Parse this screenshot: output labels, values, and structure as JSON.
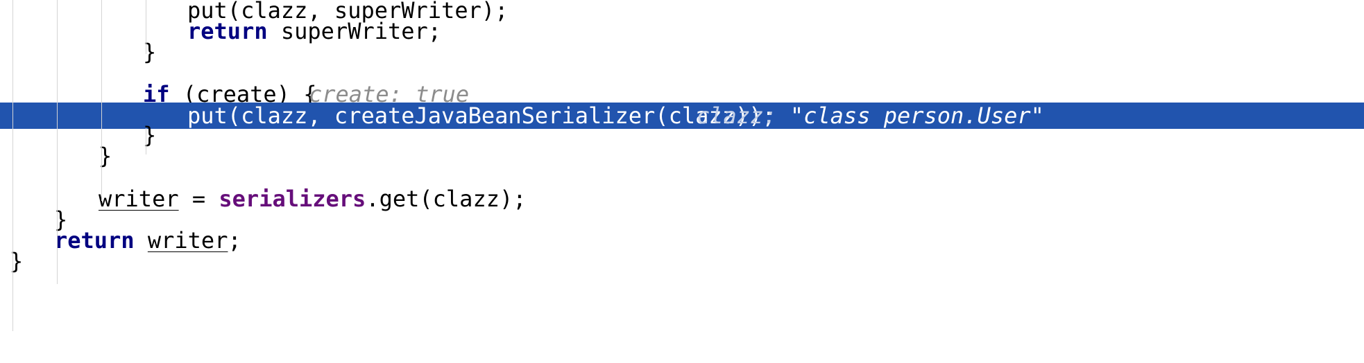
{
  "editor": {
    "lines": [
      {
        "text": "put(clazz, superWriter);"
      },
      {
        "kw": "return",
        "rest": " superWriter;"
      },
      {
        "text": "}"
      },
      {
        "kw": "if",
        "rest": " (create) {",
        "hint": "create: true"
      },
      {
        "text": "put(clazz, createJavaBeanSerializer(clazz));",
        "hint_label": "clazz:",
        "hint_value": "\"class person.User\""
      },
      {
        "text": "}"
      },
      {
        "text": "}"
      },
      {
        "var": "writer",
        "mid": " = ",
        "field": "serializers",
        "rest": ".get(clazz);"
      },
      {
        "text": "}"
      },
      {
        "kw": "return",
        "space": " ",
        "var": "writer",
        "rest": ";"
      },
      {
        "text": "}"
      }
    ]
  }
}
